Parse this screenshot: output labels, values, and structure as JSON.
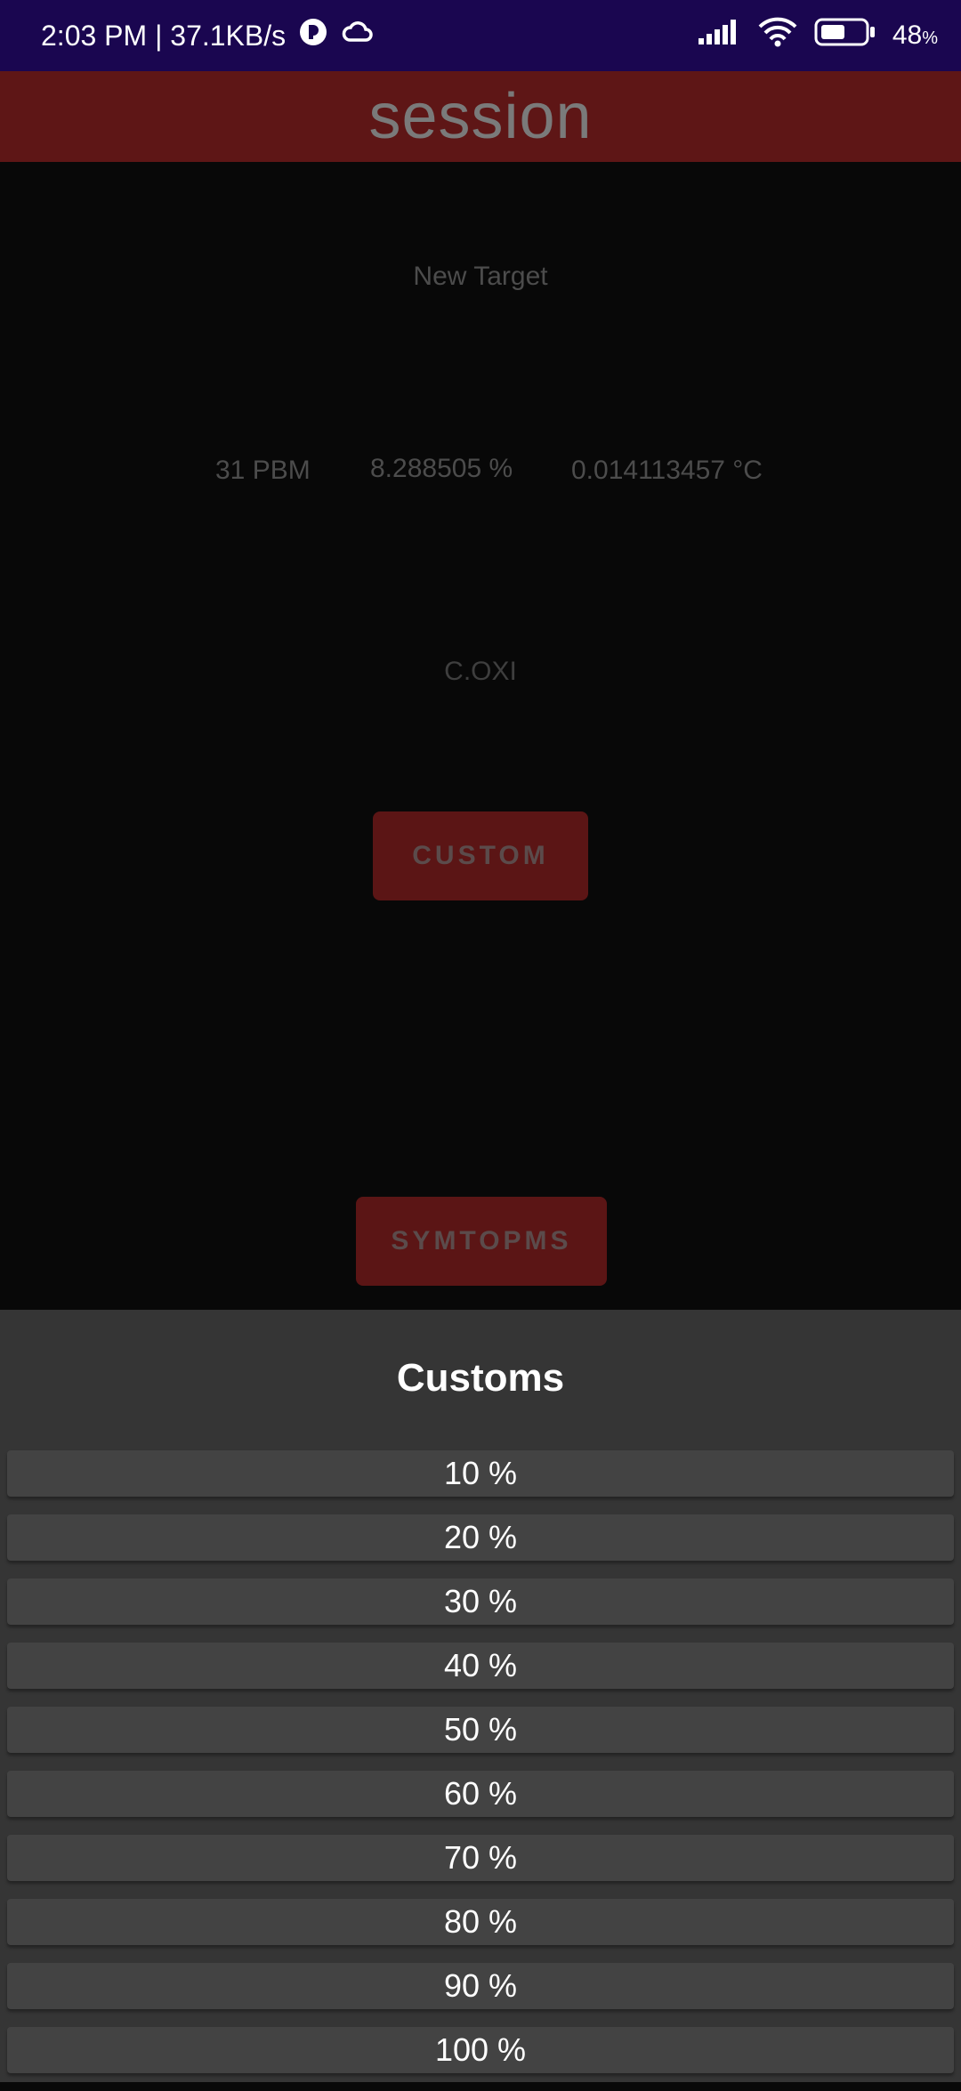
{
  "status_bar": {
    "time_speed": "2:03 PM | 37.1KB/s",
    "battery_value": "48",
    "battery_unit": "%"
  },
  "app_bar": {
    "title": "session"
  },
  "main": {
    "new_target": "New Target",
    "readings": [
      "31 PBM",
      "8.288505 %",
      "0.014113457 °C"
    ],
    "label": "C.OXI",
    "custom_button": "CUSTOM",
    "symptoms_button": "SYMTOPMS"
  },
  "sheet": {
    "title": "Customs",
    "options": [
      "10 %",
      "20 %",
      "30 %",
      "40 %",
      "50 %",
      "60 %",
      "70 %",
      "80 %",
      "90 %",
      "100 %"
    ]
  },
  "colors": {
    "status_bar_bg": "#1a0650",
    "app_bar_bg": "#5e1616",
    "button_bg": "#5b1515",
    "sheet_bg": "#353535",
    "option_bg": "#434343"
  }
}
